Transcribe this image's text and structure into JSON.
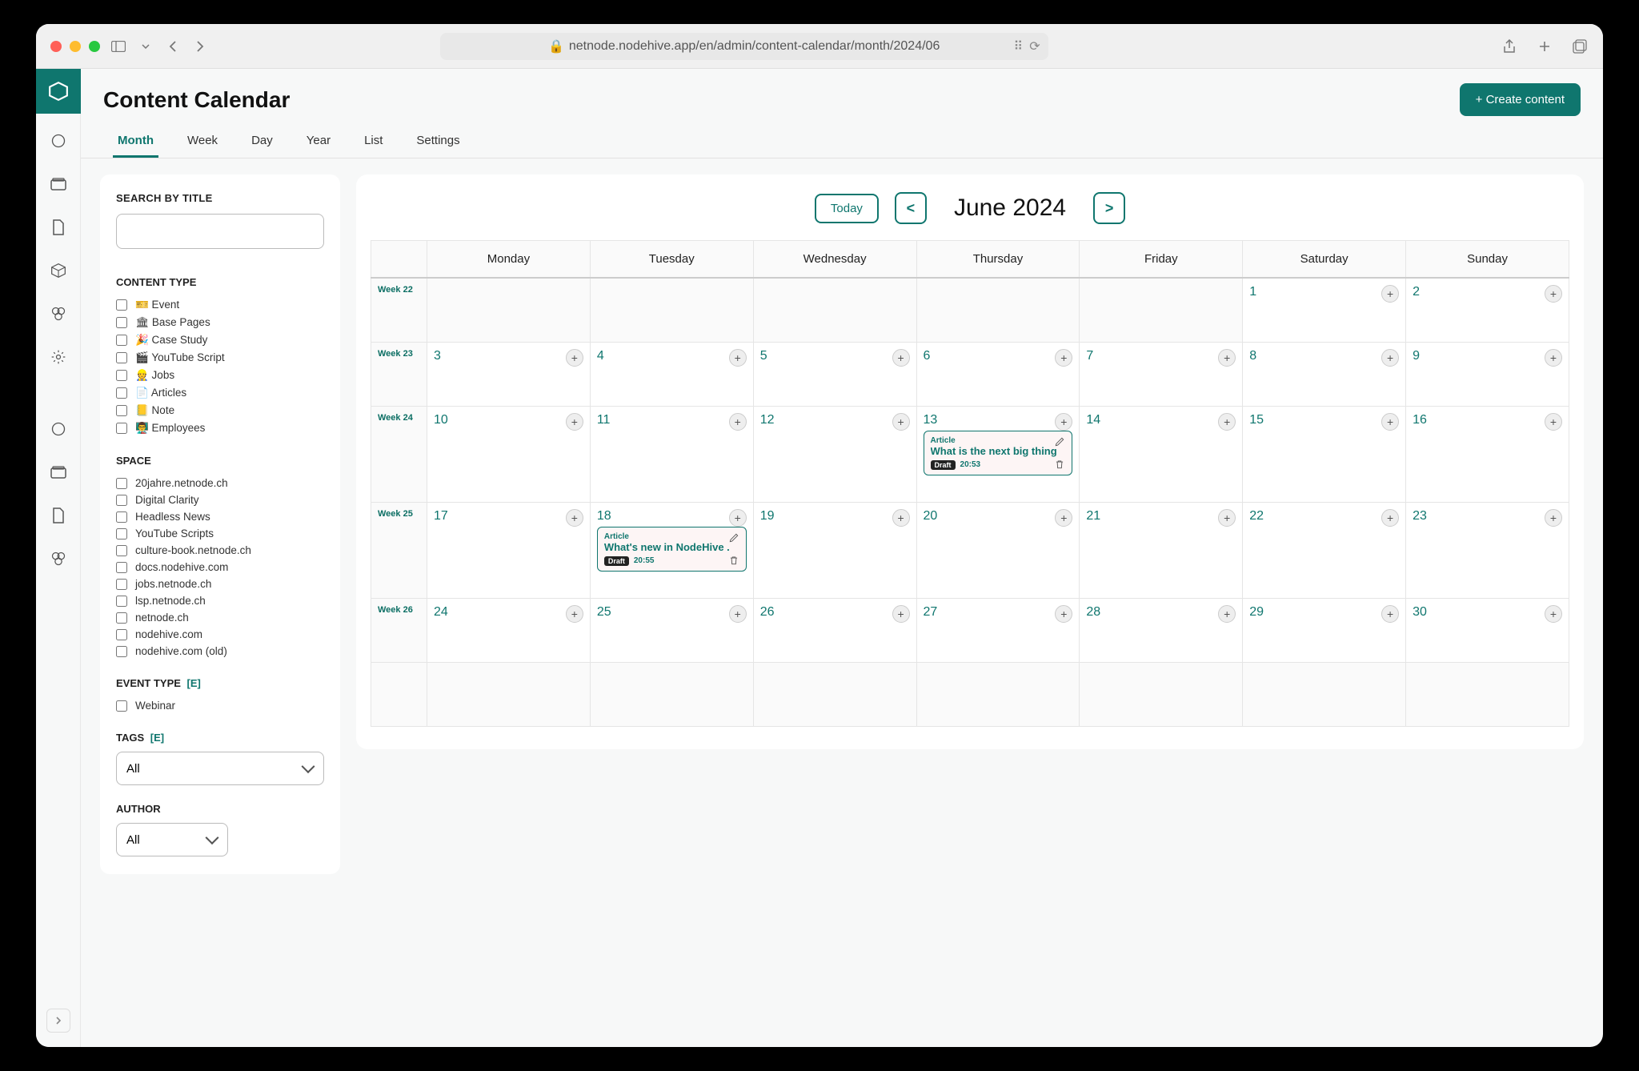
{
  "browser": {
    "url": "netnode.nodehive.app/en/admin/content-calendar/month/2024/06"
  },
  "header": {
    "title": "Content Calendar",
    "create_button": "+ Create content"
  },
  "tabs": [
    {
      "label": "Month",
      "active": true
    },
    {
      "label": "Week"
    },
    {
      "label": "Day"
    },
    {
      "label": "Year"
    },
    {
      "label": "List"
    },
    {
      "label": "Settings"
    }
  ],
  "sidebar": {
    "search_label": "SEARCH BY TITLE",
    "content_type_label": "CONTENT TYPE",
    "content_types": [
      "🎫 Event",
      "🏛 Base Pages",
      "🎉 Case Study",
      "🎬 YouTube Script",
      "👷 Jobs",
      "📄 Articles",
      "📒 Note",
      "👨‍🏫 Employees"
    ],
    "space_label": "SPACE",
    "spaces": [
      "20jahre.netnode.ch",
      "Digital Clarity",
      "Headless News",
      "YouTube Scripts",
      "culture-book.netnode.ch",
      "docs.nodehive.com",
      "jobs.netnode.ch",
      "lsp.netnode.ch",
      "netnode.ch",
      "nodehive.com",
      "nodehive.com (old)"
    ],
    "event_type_label": "EVENT TYPE",
    "event_type_edit": "[E]",
    "event_types": [
      "Webinar"
    ],
    "tags_label": "TAGS",
    "tags_edit": "[E]",
    "tags_value": "All",
    "author_label": "AUTHOR",
    "author_value": "All"
  },
  "calendar": {
    "today_label": "Today",
    "prev_label": "<",
    "next_label": ">",
    "title": "June 2024",
    "week_col_header": "",
    "day_headers": [
      "Monday",
      "Tuesday",
      "Wednesday",
      "Thursday",
      "Friday",
      "Saturday",
      "Sunday"
    ],
    "weeks": [
      {
        "label": "Week 22",
        "days": [
          {
            "num": "",
            "muted": true
          },
          {
            "num": "",
            "muted": true
          },
          {
            "num": "",
            "muted": true
          },
          {
            "num": "",
            "muted": true
          },
          {
            "num": "",
            "muted": true
          },
          {
            "num": "1"
          },
          {
            "num": "2"
          }
        ]
      },
      {
        "label": "Week 23",
        "days": [
          {
            "num": "3"
          },
          {
            "num": "4"
          },
          {
            "num": "5"
          },
          {
            "num": "6"
          },
          {
            "num": "7"
          },
          {
            "num": "8"
          },
          {
            "num": "9"
          }
        ]
      },
      {
        "label": "Week 24",
        "tall": true,
        "days": [
          {
            "num": "10"
          },
          {
            "num": "11"
          },
          {
            "num": "12"
          },
          {
            "num": "13",
            "event": {
              "type": "Article",
              "title": "What is the next big thing",
              "status": "Draft",
              "time": "20:53"
            }
          },
          {
            "num": "14"
          },
          {
            "num": "15"
          },
          {
            "num": "16"
          }
        ]
      },
      {
        "label": "Week 25",
        "tall": true,
        "days": [
          {
            "num": "17"
          },
          {
            "num": "18",
            "event": {
              "type": "Article",
              "title": "What's new in NodeHive .",
              "status": "Draft",
              "time": "20:55"
            }
          },
          {
            "num": "19"
          },
          {
            "num": "20"
          },
          {
            "num": "21"
          },
          {
            "num": "22"
          },
          {
            "num": "23"
          }
        ]
      },
      {
        "label": "Week 26",
        "days": [
          {
            "num": "24"
          },
          {
            "num": "25"
          },
          {
            "num": "26"
          },
          {
            "num": "27"
          },
          {
            "num": "28"
          },
          {
            "num": "29"
          },
          {
            "num": "30"
          }
        ]
      },
      {
        "label": "",
        "empty": true,
        "days": [
          {
            "num": "",
            "muted": true
          },
          {
            "num": "",
            "muted": true
          },
          {
            "num": "",
            "muted": true
          },
          {
            "num": "",
            "muted": true
          },
          {
            "num": "",
            "muted": true
          },
          {
            "num": "",
            "muted": true
          },
          {
            "num": "",
            "muted": true
          }
        ]
      }
    ]
  }
}
